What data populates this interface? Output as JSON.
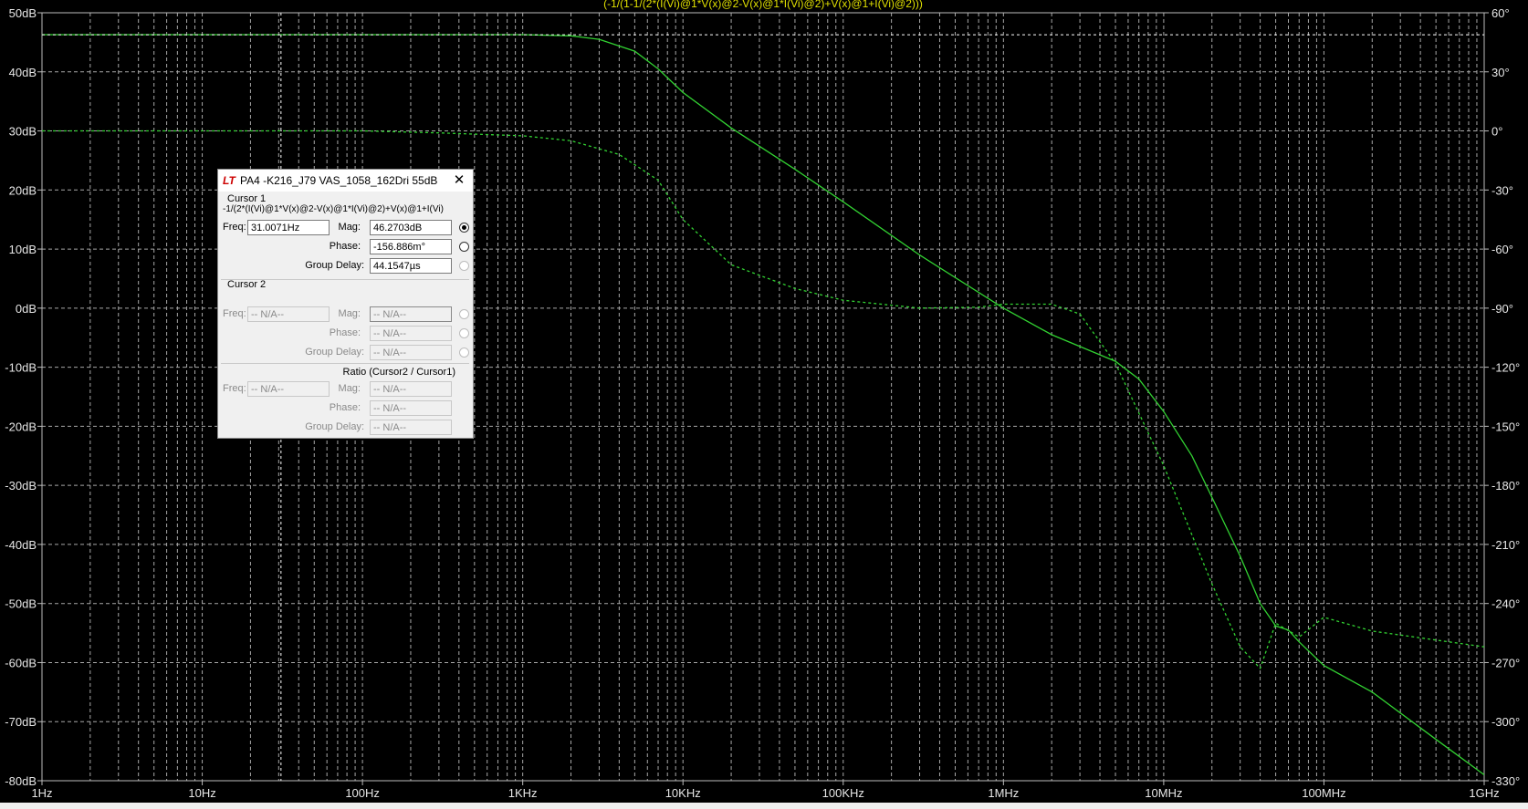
{
  "expression": "(-1/(1-1/(2*(I(Vi)@1*V(x)@2-V(x)@1*I(Vi)@2)+V(x)@1+I(Vi)@2)))",
  "chart_data": {
    "type": "line",
    "xscale": "log",
    "xlim": [
      1,
      1000000000
    ],
    "x_ticks": [
      "1Hz",
      "10Hz",
      "100Hz",
      "1KHz",
      "10KHz",
      "100KHz",
      "1MHz",
      "10MHz",
      "100MHz",
      "1GHz"
    ],
    "ylim_left": [
      -80,
      50
    ],
    "y_left_ticks": [
      "50dB",
      "40dB",
      "30dB",
      "20dB",
      "10dB",
      "0dB",
      "-10dB",
      "-20dB",
      "-30dB",
      "-40dB",
      "-50dB",
      "-60dB",
      "-70dB",
      "-80dB"
    ],
    "ylim_right": [
      -330,
      60
    ],
    "y_right_ticks": [
      "60°",
      "30°",
      "0°",
      "-30°",
      "-60°",
      "-90°",
      "-120°",
      "-150°",
      "-180°",
      "-210°",
      "-240°",
      "-270°",
      "-300°",
      "-330°"
    ],
    "grid": true,
    "series": [
      {
        "style": "solid",
        "color": "#32d232",
        "axis": "left",
        "points": [
          [
            1,
            46.3
          ],
          [
            100,
            46.3
          ],
          [
            1000,
            46.3
          ],
          [
            2000,
            46.1
          ],
          [
            3000,
            45.5
          ],
          [
            5000,
            43.5
          ],
          [
            7000,
            40.5
          ],
          [
            10000,
            36.5
          ],
          [
            20000,
            30.5
          ],
          [
            50000,
            23.5
          ],
          [
            100000,
            18
          ],
          [
            300000,
            9
          ],
          [
            1000000,
            0
          ],
          [
            2000000,
            -4.5
          ],
          [
            3000000,
            -6.5
          ],
          [
            5000000,
            -9
          ],
          [
            7000000,
            -12
          ],
          [
            10000000,
            -17.5
          ],
          [
            15000000,
            -25
          ],
          [
            20000000,
            -32
          ],
          [
            30000000,
            -42
          ],
          [
            40000000,
            -50
          ],
          [
            50000000,
            -53.8
          ],
          [
            60000000,
            -54.5
          ],
          [
            70000000,
            -56.5
          ],
          [
            100000000,
            -60.5
          ],
          [
            200000000,
            -65
          ],
          [
            500000000,
            -73
          ],
          [
            1000000000,
            -79
          ]
        ]
      },
      {
        "style": "dashed",
        "color": "#32d232",
        "axis": "right",
        "points": [
          [
            1,
            0
          ],
          [
            100,
            0
          ],
          [
            300,
            -1
          ],
          [
            1000,
            -2.5
          ],
          [
            2000,
            -5
          ],
          [
            4000,
            -12
          ],
          [
            7000,
            -25
          ],
          [
            10000,
            -45
          ],
          [
            20000,
            -68
          ],
          [
            50000,
            -80
          ],
          [
            100000,
            -86
          ],
          [
            300000,
            -90
          ],
          [
            700000,
            -89.5
          ],
          [
            1000000,
            -88
          ],
          [
            2000000,
            -88
          ],
          [
            3000000,
            -93
          ],
          [
            5000000,
            -118
          ],
          [
            10000000,
            -170
          ],
          [
            20000000,
            -230
          ],
          [
            30000000,
            -262
          ],
          [
            40000000,
            -273
          ],
          [
            50000000,
            -250
          ],
          [
            70000000,
            -257
          ],
          [
            100000000,
            -247
          ],
          [
            200000000,
            -254
          ],
          [
            1000000000,
            -262
          ]
        ]
      }
    ],
    "cursor": {
      "x": 31.0071,
      "y": 46.2703
    }
  },
  "dialog": {
    "title": "PA4 -K216_J79 VAS_1058_162Dri 55dB",
    "logo": "LT",
    "close_glyph": "✕",
    "cursor1": {
      "heading": "Cursor 1",
      "expr": "-1/(2*(I(Vi)@1*V(x)@2-V(x)@1*I(Vi)@2)+V(x)@1+I(Vi)",
      "freq_label": "Freq:",
      "freq": "31.0071Hz",
      "mag_label": "Mag:",
      "mag": "46.2703dB",
      "phase_label": "Phase:",
      "phase": "-156.886m°",
      "gd_label": "Group Delay:",
      "gd": "44.1547µs"
    },
    "cursor2": {
      "heading": "Cursor 2",
      "freq_label": "Freq:",
      "freq": "-- N/A--",
      "mag_label": "Mag:",
      "mag": "-- N/A--",
      "phase_label": "Phase:",
      "phase": "-- N/A--",
      "gd_label": "Group Delay:",
      "gd": "-- N/A--"
    },
    "ratio": {
      "heading": "Ratio (Cursor2 / Cursor1)",
      "freq_label": "Freq:",
      "freq": "-- N/A--",
      "mag_label": "Mag:",
      "mag": "-- N/A--",
      "phase_label": "Phase:",
      "phase": "-- N/A--",
      "gd_label": "Group Delay:",
      "gd": "-- N/A--"
    }
  }
}
